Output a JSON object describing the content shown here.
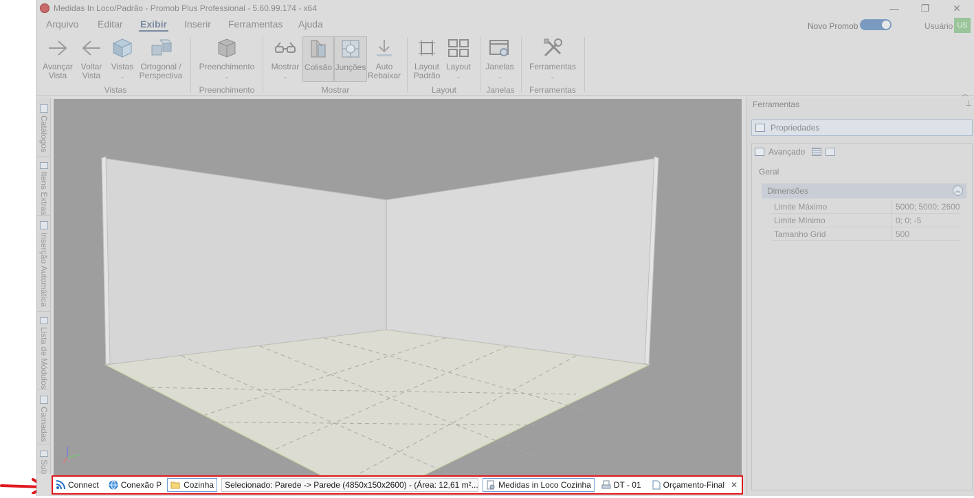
{
  "window": {
    "title": "Medidas In Loco/Padrão - Promob Plus Professional - 5.60.99.174 - x64",
    "controls": {
      "minimize": "—",
      "maximize": "❐",
      "close": "✕"
    }
  },
  "menu": {
    "items": [
      "Arquivo",
      "Editar",
      "Exibir",
      "Inserir",
      "Ferramentas",
      "Ajuda"
    ],
    "active": "Exibir",
    "novo_promob_label": "Novo Promob",
    "user_label": "Usuário",
    "user_initials": "US"
  },
  "ribbon": {
    "buttons": {
      "avancar": "Avançar Vista",
      "voltar": "Voltar Vista",
      "vistas": "Vistas",
      "ortogonal": "Ortogonal / Perspectiva",
      "preenchimento": "Preenchimento",
      "mostrar": "Mostrar",
      "colisao": "Colisão",
      "juncoes": "Junções",
      "auto_rebaixar": "Auto Rebaixar",
      "layout_padrao": "Layout Padrão",
      "layout": "Layout",
      "janelas": "Janelas",
      "ferramentas": "Ferramentas"
    },
    "groups": {
      "vistas": "Vistas",
      "preenchimento": "Preenchimento",
      "mostrar": "Mostrar",
      "layout": "Layout",
      "janelas": "Janelas",
      "ferramentas": "Ferramentas"
    },
    "caret": "⌄",
    "collapse": "︿"
  },
  "left_dock": {
    "tabs": [
      "Catálogos",
      "Itens Extras",
      "Inserção Automática",
      "Lista de Módulos",
      "Camadas",
      "Sub"
    ]
  },
  "right_panel": {
    "title": "Ferramentas",
    "pin": "⊥",
    "properties_tab": "Propriedades",
    "advanced_label": "Avançado",
    "general_label": "Geral",
    "dimensions_label": "Dimensões",
    "collapse_glyph": "︽",
    "rows": [
      {
        "key": "Limite Máximo",
        "value": "5000; 5000; 2600"
      },
      {
        "key": "Limite Mínimo",
        "value": "0; 0; -5"
      },
      {
        "key": "Tamanho Grid",
        "value": "500"
      }
    ]
  },
  "status_bar": {
    "connect": "Connect",
    "conexao": "Conexão P",
    "cozinha": "Cozinha",
    "selected": "Selecionado: Parede -> Parede (4850x150x2600) - (Área: 12,61 m²...",
    "doc1": "Medidas in Loco Cozinha",
    "doc2": "DT - 01",
    "doc3": "Orçamento-Final",
    "close": "✕"
  },
  "colors": {
    "highlight_border": "#e0191f",
    "accent": "#7a9ac0",
    "viewport_bg": "#9e9e9e"
  }
}
